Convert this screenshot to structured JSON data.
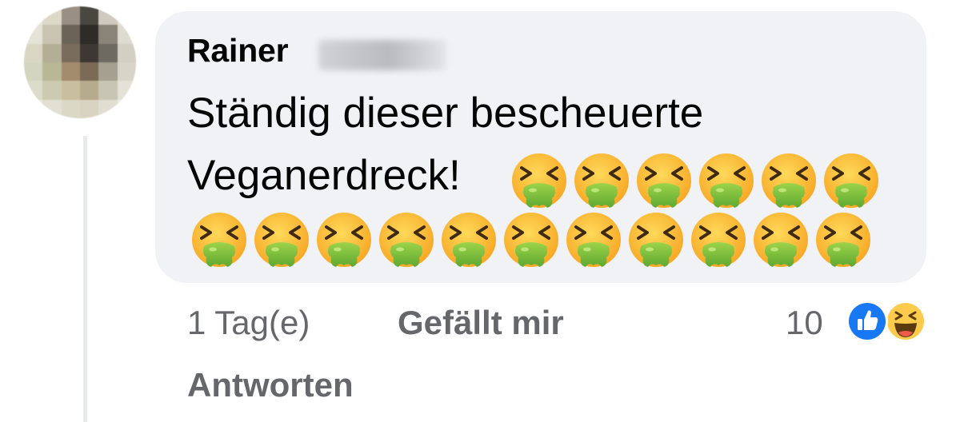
{
  "comment": {
    "author": "Rainer",
    "text_line1": "Ständig dieser bescheuerte",
    "text_line2": "Veganerdreck!",
    "emoji_name": "face-vomiting-emoji",
    "emoji_count_line2": 6,
    "emoji_count_line3": 11
  },
  "actions": {
    "timestamp": "1 Tag(e)",
    "like_label": "Gefällt mir",
    "reply_label": "Antworten"
  },
  "reactions": {
    "count": "10",
    "types": [
      "like-icon",
      "haha-icon"
    ]
  },
  "colors": {
    "bubble": "#f0f2f5",
    "meta_text": "#65676b",
    "like_blue": "#1877f2",
    "emoji_yellow": "#ffc83d",
    "vomit_green": "#8cc63e"
  }
}
